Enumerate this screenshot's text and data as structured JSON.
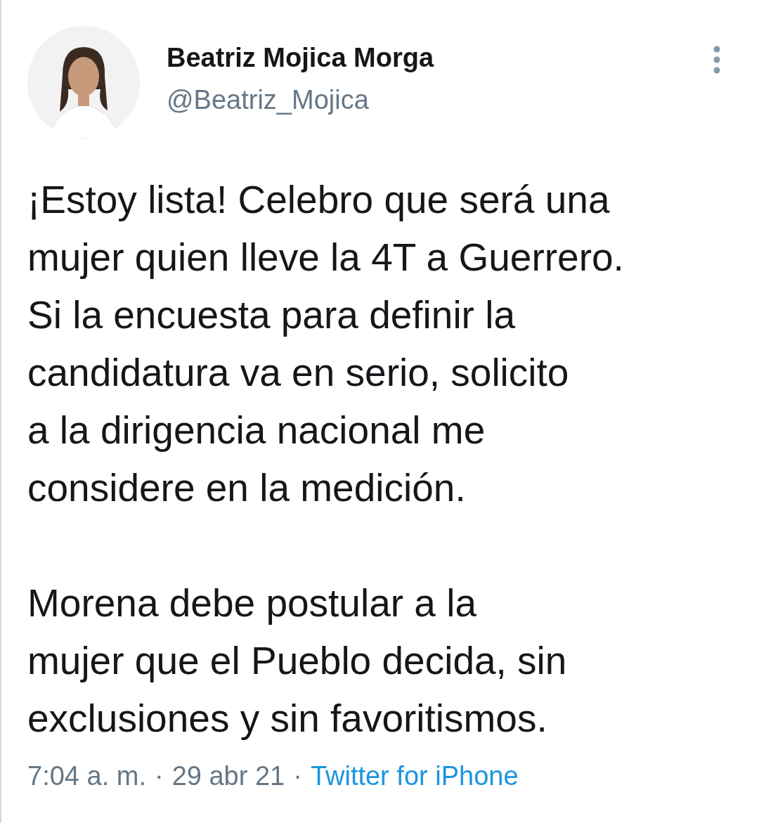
{
  "author": {
    "name": "Beatriz Mojica Morga",
    "handle": "@Beatriz_Mojica"
  },
  "tweet": {
    "paragraphs": [
      {
        "lines": [
          "¡Estoy lista! Celebro que será una",
          "mujer quien lleve la 4T a Guerrero.",
          "Si la encuesta para definir la",
          "candidatura va en serio, solicito",
          "a la dirigencia nacional me",
          "considere en la medición."
        ]
      },
      {
        "lines": [
          "Morena debe postular a la",
          "mujer que el Pueblo decida, sin",
          "exclusiones y sin favoritismos."
        ]
      }
    ]
  },
  "meta": {
    "time": "7:04 a. m.",
    "separator_1": "·",
    "date": "29 abr 21",
    "separator_2": "·",
    "source": "Twitter for iPhone"
  }
}
